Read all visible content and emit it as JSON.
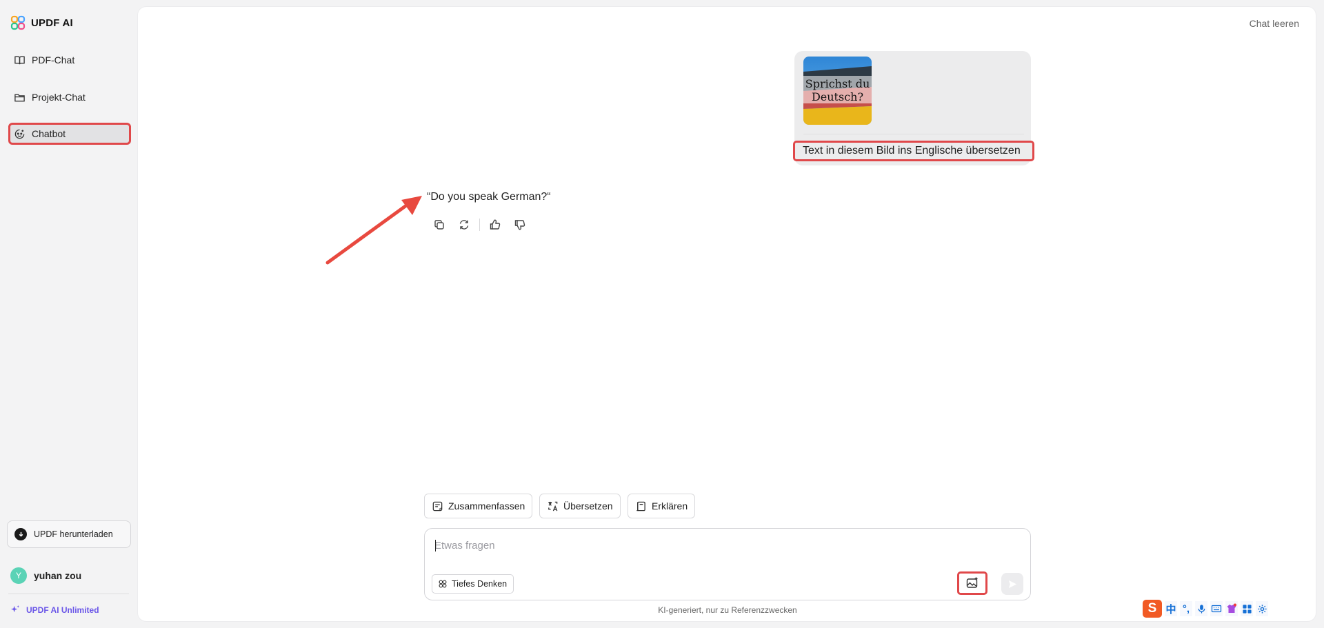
{
  "app": {
    "name": "UPDF AI"
  },
  "sidebar": {
    "items": [
      {
        "label": "PDF-Chat",
        "icon": "book-icon"
      },
      {
        "label": "Projekt-Chat",
        "icon": "folder-icon"
      },
      {
        "label": "Chatbot",
        "icon": "bot-icon",
        "active": true
      }
    ],
    "download_label": "UPDF herunterladen",
    "user": {
      "initial": "Y",
      "name": "yuhan zou"
    },
    "plan_label": "UPDF AI Unlimited"
  },
  "header": {
    "clear_chat": "Chat leeren"
  },
  "conversation": {
    "user_message": {
      "image_text_line1": "Sprichst du",
      "image_text_line2": "Deutsch?",
      "text": "Text in diesem Bild ins Englische übersetzen"
    },
    "ai_answer": "“Do you speak German?“"
  },
  "quick_actions": [
    {
      "label": "Zusammenfassen",
      "icon": "summarize-icon"
    },
    {
      "label": "Übersetzen",
      "icon": "translate-icon"
    },
    {
      "label": "Erklären",
      "icon": "explain-icon"
    }
  ],
  "composer": {
    "placeholder": "Etwas fragen",
    "deep_think_label": "Tiefes Denken",
    "disclaimer": "KI-generiert, nur zu Referenzzwecken"
  },
  "ime_tray": {
    "logo": "S",
    "lang": "中",
    "punct": "°,"
  },
  "colors": {
    "highlight": "#e0484a",
    "accent": "#6a56e8",
    "avatar": "#5bd3b6",
    "ime": "#f15a24"
  }
}
